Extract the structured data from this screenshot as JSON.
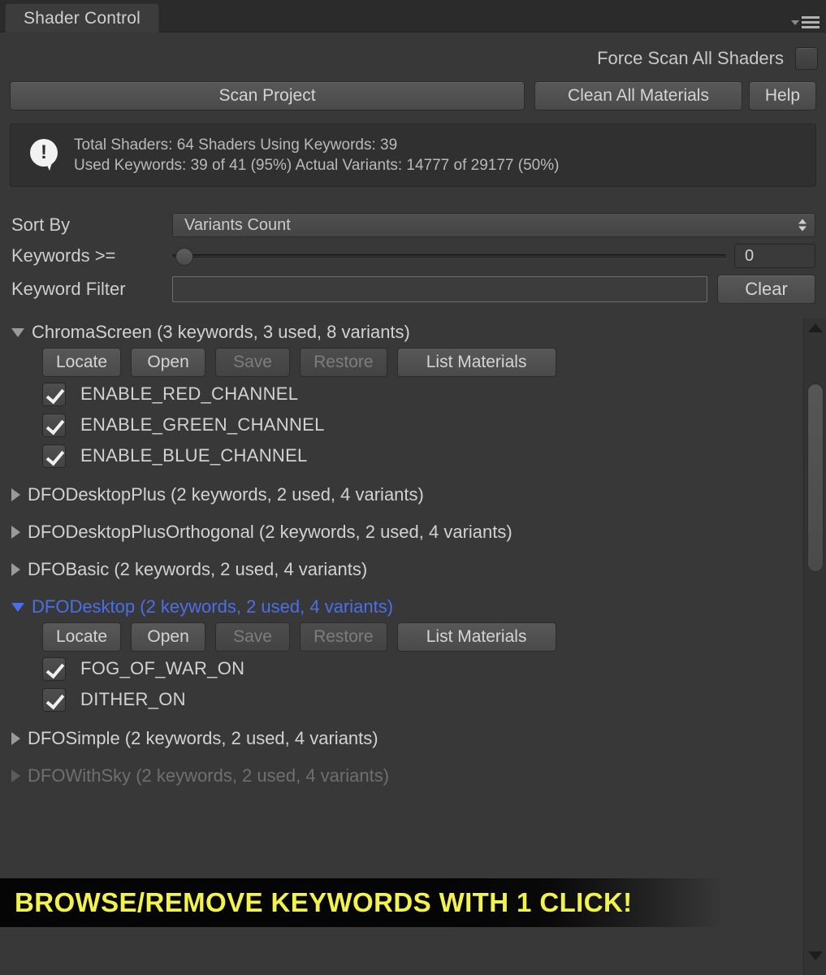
{
  "window": {
    "tab_label": "Shader Control",
    "panel_menu_icon": "panel-menu-icon"
  },
  "toolbar": {
    "force_scan_label": "Force Scan All Shaders",
    "force_scan_checked": false,
    "scan_project_label": "Scan Project",
    "clean_all_materials_label": "Clean All Materials",
    "help_label": "Help"
  },
  "info": {
    "icon": "info-exclamation-icon",
    "line1": "Total Shaders: 64  Shaders Using Keywords: 39",
    "line2": "Used Keywords: 39 of 41 (95%)  Actual Variants: 14777 of 29177 (50%)"
  },
  "filters": {
    "sort_by_label": "Sort By",
    "sort_by_value": "Variants Count",
    "keywords_ge_label": "Keywords >=",
    "keywords_ge_value": "0",
    "keyword_filter_label": "Keyword Filter",
    "keyword_filter_value": "",
    "keyword_filter_placeholder": "",
    "clear_label": "Clear"
  },
  "row_actions": {
    "locate": "Locate",
    "open": "Open",
    "save": "Save",
    "restore": "Restore",
    "list_materials": "List Materials"
  },
  "shaders": [
    {
      "name": "ChromaScreen (3 keywords, 3 used, 8 variants)",
      "expanded": true,
      "selected": false,
      "dimmed": false,
      "keywords": [
        {
          "name": "ENABLE_RED_CHANNEL",
          "checked": true
        },
        {
          "name": "ENABLE_GREEN_CHANNEL",
          "checked": true
        },
        {
          "name": "ENABLE_BLUE_CHANNEL",
          "checked": true
        }
      ]
    },
    {
      "name": "DFODesktopPlus (2 keywords, 2 used, 4 variants)",
      "expanded": false,
      "selected": false,
      "dimmed": false,
      "keywords": []
    },
    {
      "name": "DFODesktopPlusOrthogonal (2 keywords, 2 used, 4 variants)",
      "expanded": false,
      "selected": false,
      "dimmed": false,
      "keywords": []
    },
    {
      "name": "DFOBasic (2 keywords, 2 used, 4 variants)",
      "expanded": false,
      "selected": false,
      "dimmed": false,
      "keywords": []
    },
    {
      "name": "DFODesktop (2 keywords, 2 used, 4 variants)",
      "expanded": true,
      "selected": true,
      "dimmed": false,
      "keywords": [
        {
          "name": "FOG_OF_WAR_ON",
          "checked": true
        },
        {
          "name": "DITHER_ON",
          "checked": true
        }
      ]
    },
    {
      "name": "DFOSimple (2 keywords, 2 used, 4 variants)",
      "expanded": false,
      "selected": false,
      "dimmed": false,
      "keywords": []
    },
    {
      "name": "DFOWithSky (2 keywords, 2 used, 4 variants)",
      "expanded": false,
      "selected": false,
      "dimmed": true,
      "keywords": []
    }
  ],
  "scrollbar": {
    "up_arrow_icon": "scroll-up-arrow-icon",
    "down_arrow_icon": "scroll-down-arrow-icon"
  },
  "banner": {
    "text": "BROWSE/REMOVE KEYWORDS WITH 1 CLICK!",
    "color": "#f2f24a"
  },
  "colors": {
    "background": "#383838",
    "panel": "#303030",
    "accent_selected": "#4a6fe8",
    "text": "#d2d2d2"
  }
}
